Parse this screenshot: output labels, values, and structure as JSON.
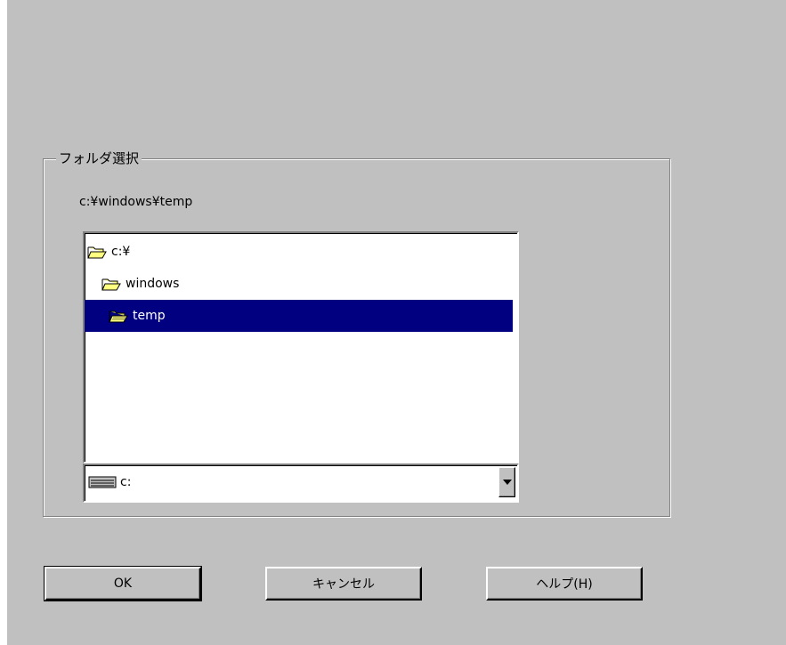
{
  "dialog": {
    "group_title": "フォルダ選択",
    "current_path": "c:¥windows¥temp"
  },
  "tree": {
    "items": [
      {
        "label": "c:¥",
        "icon": "open-folder-icon",
        "selected": false
      },
      {
        "label": "windows",
        "icon": "open-folder-icon",
        "selected": false
      },
      {
        "label": "temp",
        "icon": "open-folder-icon",
        "selected": true
      }
    ]
  },
  "drive": {
    "icon": "drive-icon",
    "selected_value": "c:"
  },
  "buttons": {
    "ok_label": "OK",
    "cancel_label": "キャンセル",
    "help_label": "ヘルプ(H)"
  },
  "colors": {
    "dialog_bg": "#c0c0c0",
    "selection_bg": "#000080",
    "selection_text": "#ffffff",
    "folder_yellow": "#ffff80"
  }
}
